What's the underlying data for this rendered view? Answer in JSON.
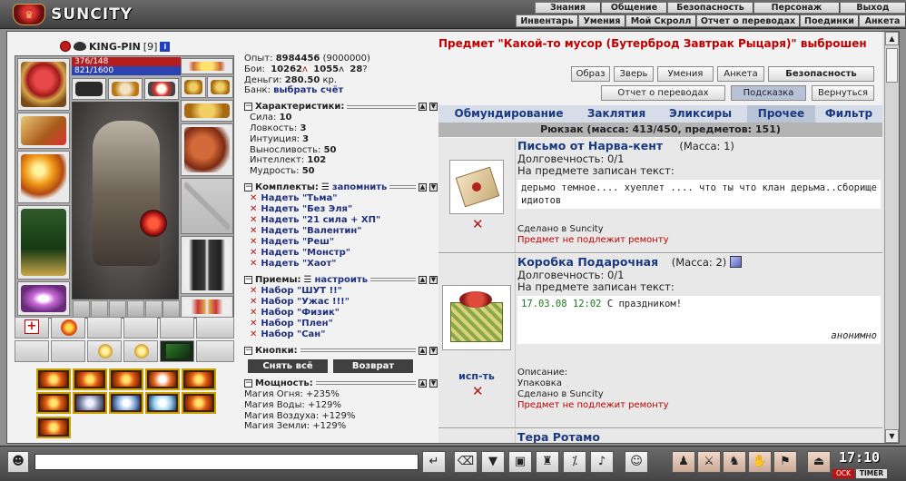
{
  "brand": {
    "name": "SUNCITY"
  },
  "top_menu_row1": [
    "Знания",
    "Общение",
    "Безопасность",
    "Персонаж",
    "Выход"
  ],
  "top_menu_row2": [
    "Инвентарь",
    "Умения",
    "Мой Скролл",
    "Отчет о переводах",
    "Поединки",
    "Анкета"
  ],
  "character": {
    "name": "KING-PIN",
    "level": "[9]",
    "hp": "376/148",
    "mp": "821/1600"
  },
  "stats": {
    "exp_label": "Опыт:",
    "exp": "8984456",
    "exp_next": "(9000000)",
    "fights_label": "Бои:",
    "wins": "10262",
    "losses": "1055",
    "draws": "28",
    "money_label": "Деньги:",
    "money": "280.50",
    "money_unit": "кр.",
    "bank_label": "Банк:",
    "bank_link": "выбрать счёт"
  },
  "attributes": {
    "title": "Характеристики:",
    "rows": [
      {
        "label": "Сила:",
        "value": "10"
      },
      {
        "label": "Ловкость:",
        "value": "3"
      },
      {
        "label": "Интуиция:",
        "value": "3"
      },
      {
        "label": "Выносливость:",
        "value": "50"
      },
      {
        "label": "Интеллект:",
        "value": "102"
      },
      {
        "label": "Мудрость:",
        "value": "50"
      }
    ]
  },
  "sets": {
    "title": "Комплекты:",
    "action": "запомнить",
    "items": [
      "Надеть \"Тьма\"",
      "Надеть \"Без Эля\"",
      "Надеть \"21 сила + ХП\"",
      "Надеть \"Валентин\"",
      "Надеть \"Реш\"",
      "Надеть \"Монстр\"",
      "Надеть \"Хаот\""
    ]
  },
  "tricks": {
    "title": "Приемы:",
    "action": "настроить",
    "items": [
      "Набор \"ШУТ !!\"",
      "Набор \"Ужас !!!\"",
      "Набор \"Физик\"",
      "Набор \"Плен\"",
      "Набор \"Сан\""
    ]
  },
  "buttons_section": {
    "title": "Кнопки:",
    "remove_all": "Снять всё",
    "return": "Возврат"
  },
  "power": {
    "title": "Мощность:",
    "rows": [
      "Магия Огня: +235%",
      "Магия Воды: +129%",
      "Магия Воздуха: +129%",
      "Магия Земли: +129%"
    ]
  },
  "notice": "Предмет \"Какой-то мусор (Бутерброд Завтрак Рыцаря)\" выброшен",
  "right_buttons": {
    "obraz": "Образ",
    "zver": "Зверь",
    "umeniya": "Умения",
    "anketa": "Анкета",
    "security": "Безопасность",
    "transfers": "Отчет о переводах",
    "hint": "Подсказка",
    "back": "Вернуться"
  },
  "inv_tabs": [
    "Обмундирование",
    "Заклятия",
    "Эликсиры",
    "Прочее",
    "Фильтр"
  ],
  "inv_active_tab": "Прочее",
  "bag_title": "Рюкзак (масса: 413/450, предметов: 151)",
  "items": [
    {
      "name": "Письмо от Нарва-кент",
      "mass": "(Масса: 1)",
      "durability": "Долговечность: 0/1",
      "written_label": "На предмете записан текст:",
      "text": "дерьмо темное.... хуеплет .... что ты что клан дерьма..сборище идиотов",
      "made": "Сделано в Suncity",
      "repair": "Предмет не подлежит ремонту"
    },
    {
      "name": "Коробка Подарочная",
      "mass": "(Масса: 2)",
      "durability": "Долговечность: 0/1",
      "written_label": "На предмете записан текст:",
      "date": "17.03.08 12:02",
      "text": "С праздником!",
      "signature": "анонимно",
      "use": "исп-ть",
      "desc_label": "Описание:",
      "desc": "Упаковка",
      "made": "Сделано в Suncity",
      "repair": "Предмет не подлежит ремонту"
    },
    {
      "name": "Тера Ротамо"
    }
  ],
  "timer": {
    "clock": "17:10",
    "ock": "OCK",
    "label": "TIMER"
  },
  "colors": {
    "link": "#1a3a80",
    "alert": "#c00000",
    "hp": "#b51c1c",
    "mp": "#2a43b0"
  }
}
